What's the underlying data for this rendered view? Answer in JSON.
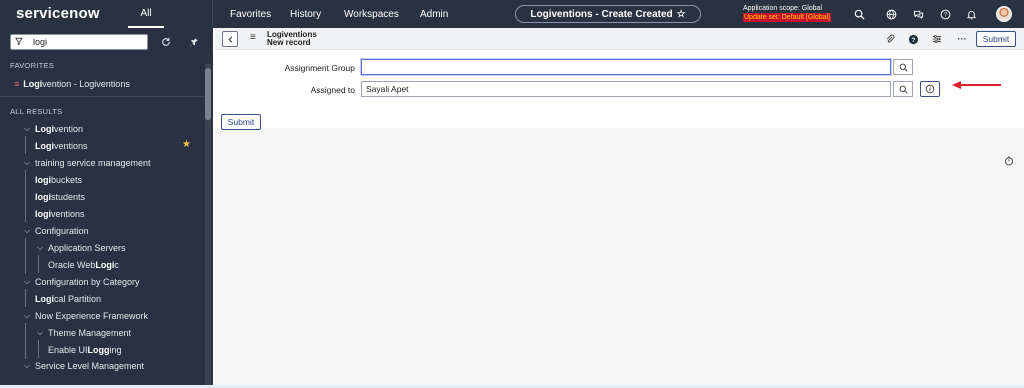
{
  "header": {
    "logo": "servicenow",
    "all_tab": "All",
    "nav": [
      "Favorites",
      "History",
      "Workspaces",
      "Admin"
    ],
    "title": "Logiventions - Create Created",
    "scope_line": "Application scope: Global",
    "update_set": "Update set: Default [Global]"
  },
  "sidebar": {
    "filter_value": "logi",
    "favorites_heading": "FAVORITES",
    "favorite_item": {
      "match": "Logi",
      "rest": "vention - Logiventions"
    },
    "results_heading": "ALL RESULTS",
    "items": [
      {
        "pre": "",
        "match": "Logi",
        "post": "vention"
      },
      {
        "pre": "",
        "match": "Logi",
        "post": "ventions"
      },
      {
        "pre": "training service management",
        "match": "",
        "post": ""
      },
      {
        "pre": "",
        "match": "logi",
        "post": " buckets"
      },
      {
        "pre": "",
        "match": "logi",
        "post": " students"
      },
      {
        "pre": "",
        "match": "logi",
        "post": "ventions"
      },
      {
        "pre": "Configuration",
        "match": "",
        "post": ""
      },
      {
        "pre": "Application Servers",
        "match": "",
        "post": ""
      },
      {
        "pre": "Oracle Web",
        "match": "Logi",
        "post": "c"
      },
      {
        "pre": "Configuration by Category",
        "match": "",
        "post": ""
      },
      {
        "pre": "",
        "match": "Logi",
        "post": "cal Partition"
      },
      {
        "pre": "Now Experience Framework",
        "match": "",
        "post": ""
      },
      {
        "pre": "Theme Management",
        "match": "",
        "post": ""
      },
      {
        "pre": "Enable UI ",
        "match": "Logg",
        "post": "ing"
      },
      {
        "pre": "Service Level Management",
        "match": "",
        "post": ""
      }
    ]
  },
  "form": {
    "record_name": "Logiventions",
    "record_state": "New record",
    "submit_label": "Submit",
    "assignment_group_label": "Assignment Group",
    "assignment_group_value": "",
    "assigned_to_label": "Assigned to",
    "assigned_to_value": "Sayali Apet",
    "bottom_submit_label": "Submit"
  },
  "colors": {
    "header_bg": "#293241",
    "sidebar_bg": "#2a3142",
    "accent": "#3b4c8a",
    "annotation_arrow": "#d8232a",
    "update_set_bg": "#c8102e"
  }
}
